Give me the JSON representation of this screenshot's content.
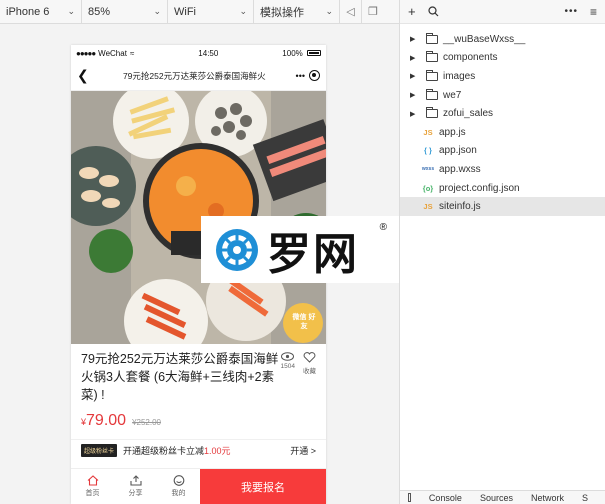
{
  "toolbar": {
    "device": "iPhone 6",
    "zoom": "85%",
    "network": "WiFi",
    "mode": "模拟操作"
  },
  "phone": {
    "status": {
      "carrier": "WeChat",
      "time": "14:50",
      "battery": "100%"
    },
    "nav_title": "79元抢252元万达莱莎公爵泰国海鲜火",
    "hero_badge": "微信 好友",
    "product": {
      "title": "79元抢252元万达莱莎公爵泰国海鲜火锅3人套餐 (6大海鲜+三线肉+2素菜) !",
      "views": "1504",
      "fav_label": "收藏",
      "currency": "¥",
      "price": "79.00",
      "orig_price": "¥252.00"
    },
    "promo": {
      "tag": "超级粉丝卡",
      "text_before": "开通超级粉丝卡立减",
      "amount": "1.00元",
      "more": "开通 >"
    },
    "bottom_bar": {
      "home": "首页",
      "share": "分享",
      "mine": "我的",
      "cta": "我要报名"
    }
  },
  "watermark": {
    "text": "罗网",
    "reg": "®"
  },
  "file_tree": [
    {
      "name": "__wuBaseWxss__",
      "type": "folder"
    },
    {
      "name": "components",
      "type": "folder"
    },
    {
      "name": "images",
      "type": "folder"
    },
    {
      "name": "we7",
      "type": "folder"
    },
    {
      "name": "zofui_sales",
      "type": "folder"
    },
    {
      "name": "app.js",
      "type": "js",
      "icon": "JS"
    },
    {
      "name": "app.json",
      "type": "json",
      "icon": "{ }"
    },
    {
      "name": "app.wxss",
      "type": "wxss",
      "icon": "wxss"
    },
    {
      "name": "project.config.json",
      "type": "config",
      "icon": "{o}"
    },
    {
      "name": "siteinfo.js",
      "type": "js",
      "icon": "JS",
      "selected": true
    }
  ],
  "bottom_tabs": [
    "Console",
    "Sources",
    "Network",
    "S"
  ]
}
